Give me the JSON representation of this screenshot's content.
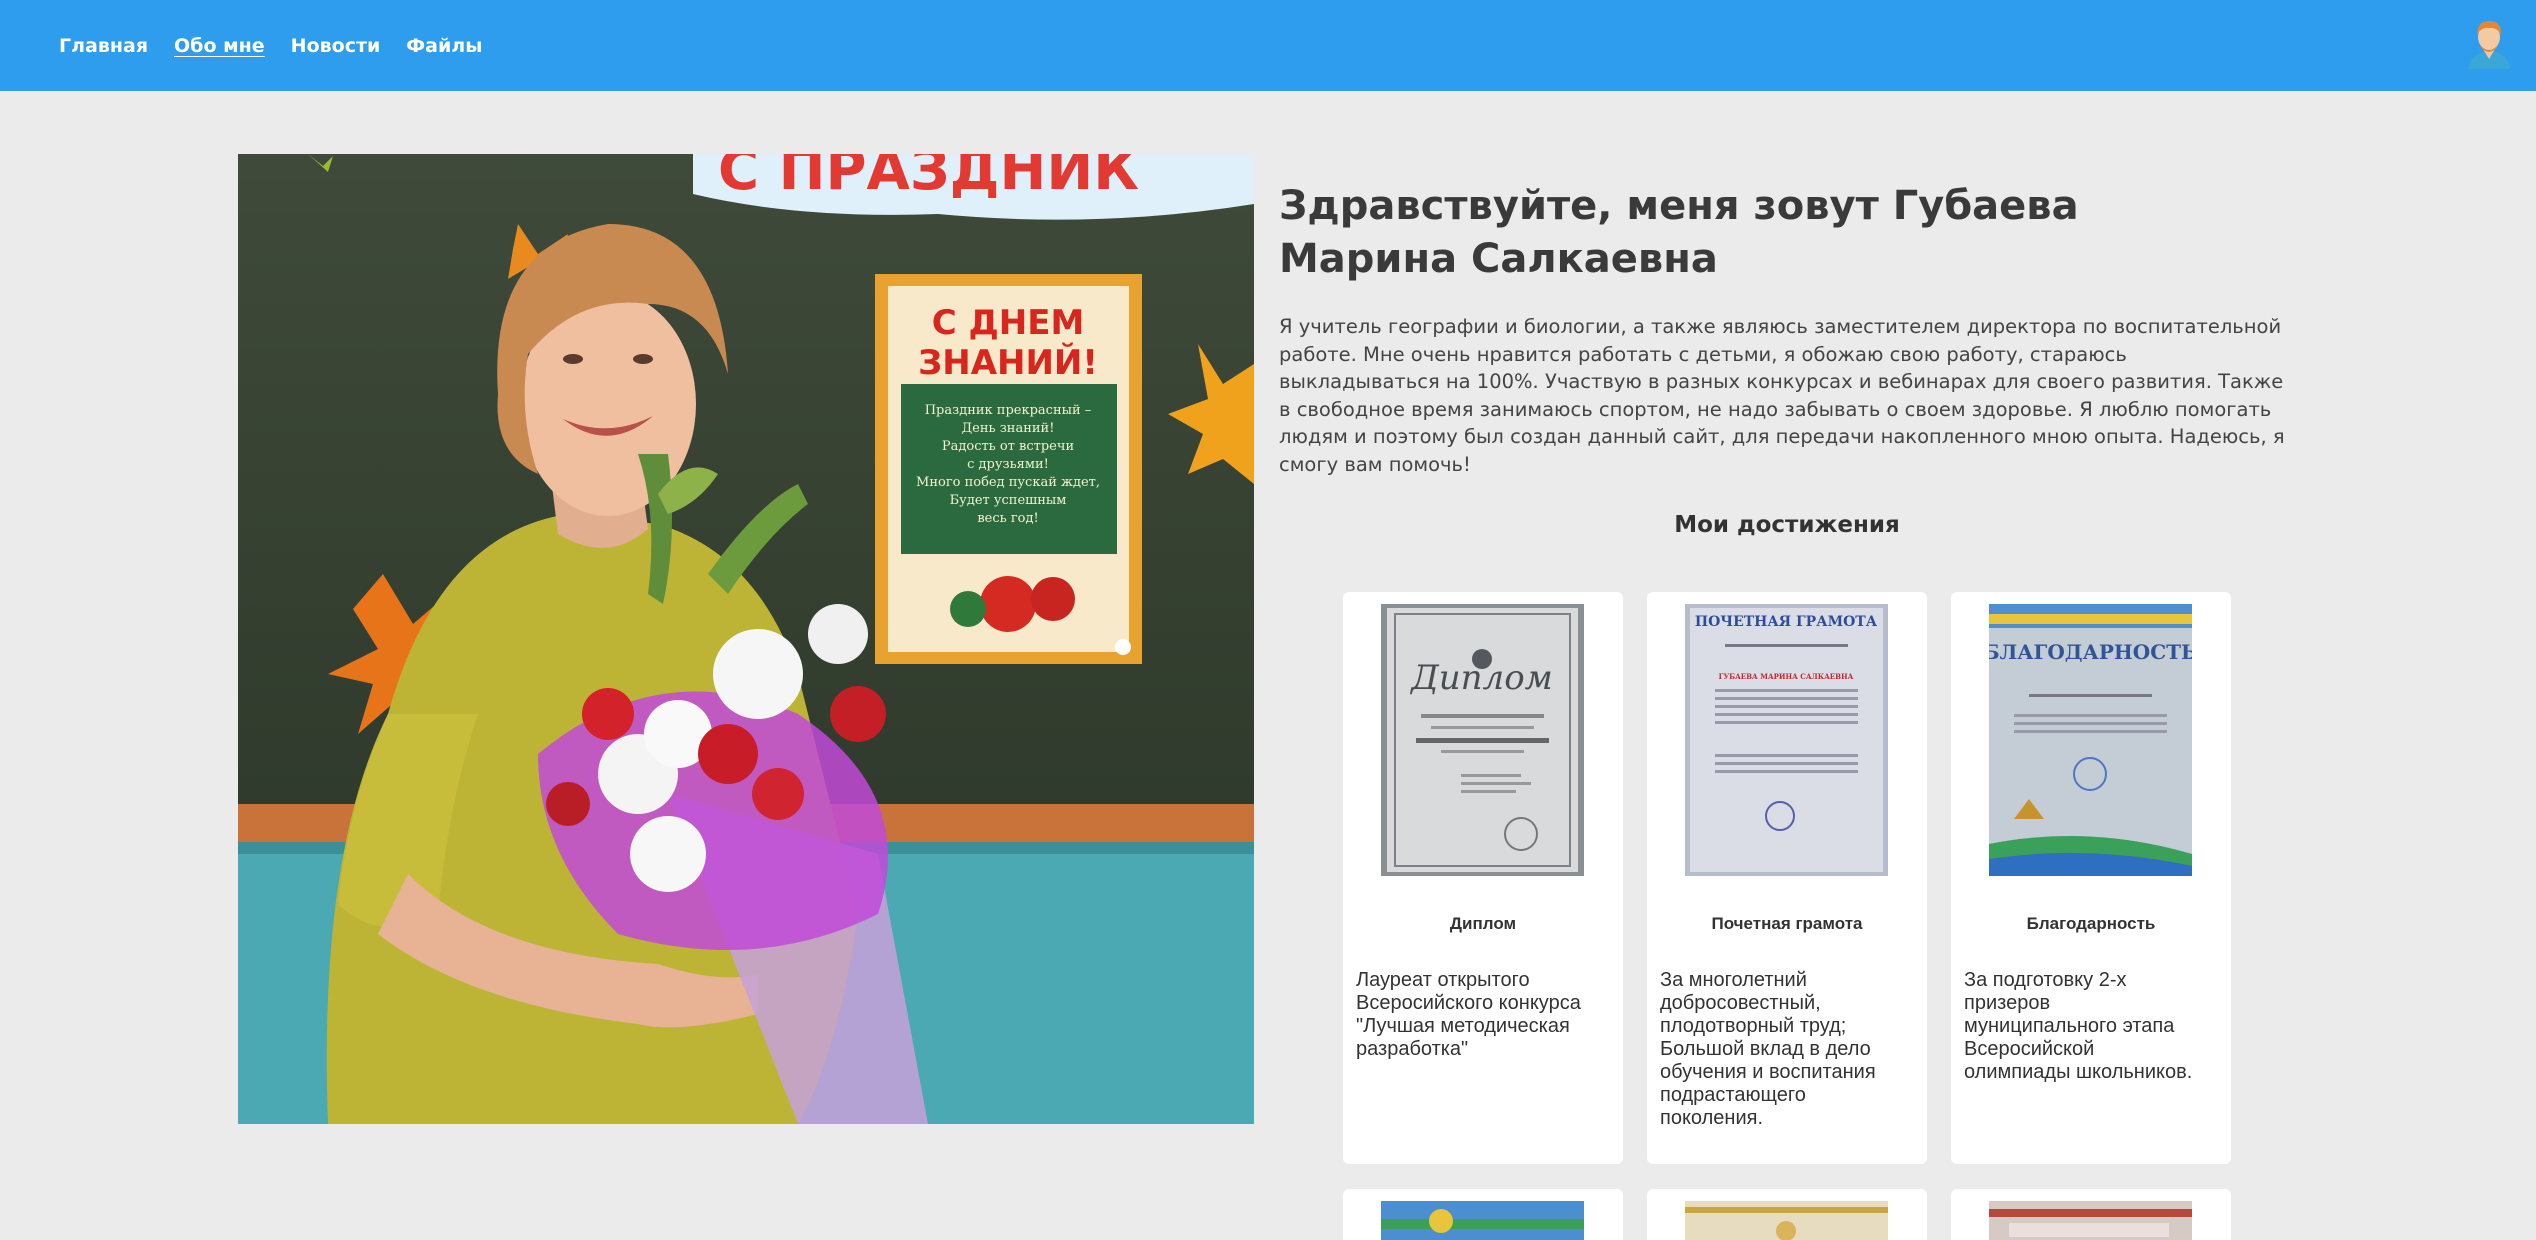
{
  "nav": {
    "items": [
      {
        "label": "Главная"
      },
      {
        "label": "Обо мне"
      },
      {
        "label": "Новости"
      },
      {
        "label": "Файлы"
      }
    ],
    "avatar_icon": "user-avatar-icon"
  },
  "intro": {
    "greeting": "Здравствуйте, меня зовут Губаева Марина Салкаевна",
    "about": "Я учитель географии и биологии, а также являюсь заместителем директора по воспитательной работе. Мне очень нравится работать с детьми, я обожаю свою работу, стараюсь выкладываться на 100%. Участвую в разных конкурсах и вебинарах для своего развития. Также в свободное время занимаюсь спортом, не надо забывать о своем здоровье. Я люблю помогать людям и поэтому был создан данный сайт, для передачи накопленного мною опыта. Надеюсь, я смогу вам помочь!"
  },
  "photo": {
    "poster_title": "С ДНЕМ ЗНАНИЙ!",
    "poster_text": "Праздник прекрасный – День знаний! Радость от встречи с друзьями! Много побед пускай ждет, Будет успешным весь год!",
    "banner": "С ПРАЗДНИК"
  },
  "achievements": {
    "title": "Мои достижения",
    "cards": [
      {
        "thumb_heading": "Диплом",
        "title": "Диплом",
        "text": "Лауреат открытого Всеросийского конкурса \"Лучшая методическая разработка\""
      },
      {
        "thumb_heading": "ПОЧЕТНАЯ ГРАМОТА",
        "thumb_name": "ГУБАЕВА МАРИНА САЛКАЕВНА",
        "title": "Почетная грамота",
        "text": "За многолетний добросовестный, плодотворный труд; Большой вклад в дело обучения и воспитания подрастающего поколения."
      },
      {
        "thumb_heading": "БЛАГОДАРНОСТЬ",
        "title": "Благодарность",
        "text": "За подготовку 2-х призеров муниципального этапа Всеросийской олимпиады школьников."
      }
    ]
  },
  "colors": {
    "navbar": "#2f9ded",
    "background": "#ebebeb",
    "card": "#ffffff"
  }
}
